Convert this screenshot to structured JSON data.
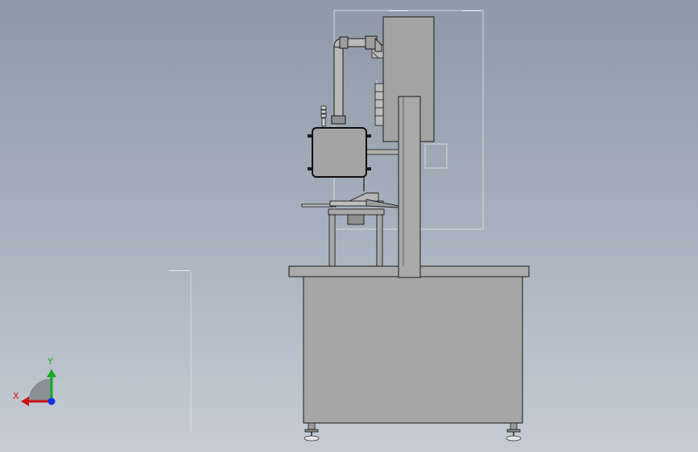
{
  "viewport": {
    "background_top": "#8d99a8",
    "background_bottom": "#c5ccd5",
    "part_fill": "#a6a6a6",
    "part_outline": "#1a1a1a"
  },
  "triad": {
    "x_label": "X",
    "y_label": "Y",
    "x_color": "#cc1111",
    "y_color": "#11aa22",
    "z_color": "#1133dd"
  },
  "model_components": [
    "base-cabinet",
    "tabletop",
    "leveling-feet",
    "vertical-column",
    "head-housing",
    "side-motor-box",
    "bent-pipe",
    "work-table",
    "horizontal-arm"
  ]
}
